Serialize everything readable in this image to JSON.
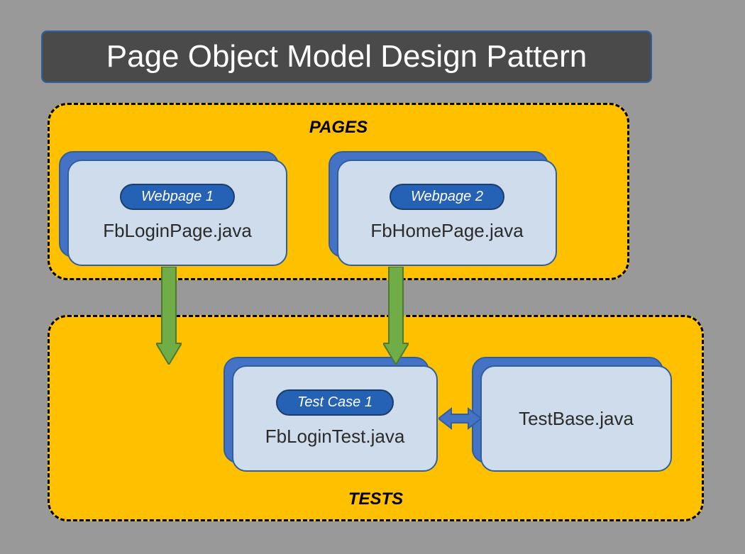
{
  "title": "Page Object Model Design Pattern",
  "sections": {
    "pages": {
      "label": "PAGES"
    },
    "tests": {
      "label": "TESTS"
    }
  },
  "cards": {
    "page1": {
      "badge": "Webpage 1",
      "label": "FbLoginPage.java"
    },
    "page2": {
      "badge": "Webpage 2",
      "label": "FbHomePage.java"
    },
    "test1": {
      "badge": "Test Case 1",
      "label": "FbLoginTest.java"
    },
    "test2": {
      "label": "TestBase.java"
    }
  }
}
